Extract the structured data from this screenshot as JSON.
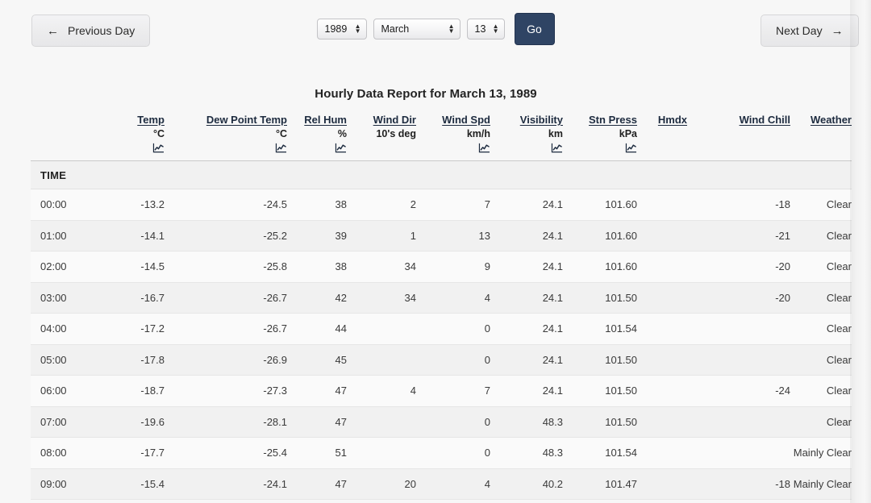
{
  "nav": {
    "prev_label": "Previous Day",
    "prev_icon": "arrow-left-icon",
    "prev_arrow": "←",
    "next_label": "Next Day",
    "next_icon": "arrow-right-icon",
    "next_arrow": "→",
    "go_label": "Go"
  },
  "date_picker": {
    "year": "1989",
    "month": "March",
    "day": "13",
    "spinner_up": "▲",
    "spinner_down": "▼"
  },
  "report": {
    "title": "Hourly Data Report for March 13, 1989",
    "time_header": "TIME"
  },
  "colors": {
    "page_background": "#f7f7f7",
    "go_button": "#2f4464",
    "header_link": "#1d2b3f",
    "row_odd": "#fafafa",
    "row_even": "#f1f1f1",
    "row_border": "#e6e6e6",
    "text": "#3a3a3a"
  },
  "columns": [
    {
      "key": "time",
      "name": "",
      "unit": "",
      "icon": ""
    },
    {
      "key": "temp",
      "name": "Temp",
      "unit": "°C",
      "icon": "line-chart-icon"
    },
    {
      "key": "dew_point",
      "name": "Dew Point Temp",
      "unit": "°C",
      "icon": "line-chart-icon"
    },
    {
      "key": "rel_hum",
      "name": "Rel Hum",
      "unit": "%",
      "icon": "line-chart-icon"
    },
    {
      "key": "wind_dir",
      "name": "Wind Dir",
      "unit": "10's deg",
      "icon": ""
    },
    {
      "key": "wind_spd",
      "name": "Wind Spd",
      "unit": "km/h",
      "icon": "line-chart-icon"
    },
    {
      "key": "visibility",
      "name": "Visibility",
      "unit": "km",
      "icon": "line-chart-icon"
    },
    {
      "key": "stn_press",
      "name": "Stn Press",
      "unit": "kPa",
      "icon": "line-chart-icon"
    },
    {
      "key": "hmdx",
      "name": "Hmdx",
      "unit": "",
      "icon": ""
    },
    {
      "key": "wind_chill",
      "name": "Wind Chill",
      "unit": "",
      "icon": ""
    },
    {
      "key": "weather",
      "name": "Weather",
      "unit": "",
      "icon": ""
    }
  ],
  "rows": [
    {
      "time": "00:00",
      "temp": "-13.2",
      "dew_point": "-24.5",
      "rel_hum": "38",
      "wind_dir": "2",
      "wind_spd": "7",
      "visibility": "24.1",
      "stn_press": "101.60",
      "hmdx": "",
      "wind_chill": "-18",
      "weather": "Clear"
    },
    {
      "time": "01:00",
      "temp": "-14.1",
      "dew_point": "-25.2",
      "rel_hum": "39",
      "wind_dir": "1",
      "wind_spd": "13",
      "visibility": "24.1",
      "stn_press": "101.60",
      "hmdx": "",
      "wind_chill": "-21",
      "weather": "Clear"
    },
    {
      "time": "02:00",
      "temp": "-14.5",
      "dew_point": "-25.8",
      "rel_hum": "38",
      "wind_dir": "34",
      "wind_spd": "9",
      "visibility": "24.1",
      "stn_press": "101.60",
      "hmdx": "",
      "wind_chill": "-20",
      "weather": "Clear"
    },
    {
      "time": "03:00",
      "temp": "-16.7",
      "dew_point": "-26.7",
      "rel_hum": "42",
      "wind_dir": "34",
      "wind_spd": "4",
      "visibility": "24.1",
      "stn_press": "101.50",
      "hmdx": "",
      "wind_chill": "-20",
      "weather": "Clear"
    },
    {
      "time": "04:00",
      "temp": "-17.2",
      "dew_point": "-26.7",
      "rel_hum": "44",
      "wind_dir": "",
      "wind_spd": "0",
      "visibility": "24.1",
      "stn_press": "101.54",
      "hmdx": "",
      "wind_chill": "",
      "weather": "Clear"
    },
    {
      "time": "05:00",
      "temp": "-17.8",
      "dew_point": "-26.9",
      "rel_hum": "45",
      "wind_dir": "",
      "wind_spd": "0",
      "visibility": "24.1",
      "stn_press": "101.50",
      "hmdx": "",
      "wind_chill": "",
      "weather": "Clear"
    },
    {
      "time": "06:00",
      "temp": "-18.7",
      "dew_point": "-27.3",
      "rel_hum": "47",
      "wind_dir": "4",
      "wind_spd": "7",
      "visibility": "24.1",
      "stn_press": "101.50",
      "hmdx": "",
      "wind_chill": "-24",
      "weather": "Clear"
    },
    {
      "time": "07:00",
      "temp": "-19.6",
      "dew_point": "-28.1",
      "rel_hum": "47",
      "wind_dir": "",
      "wind_spd": "0",
      "visibility": "48.3",
      "stn_press": "101.50",
      "hmdx": "",
      "wind_chill": "",
      "weather": "Clear"
    },
    {
      "time": "08:00",
      "temp": "-17.7",
      "dew_point": "-25.4",
      "rel_hum": "51",
      "wind_dir": "",
      "wind_spd": "0",
      "visibility": "48.3",
      "stn_press": "101.54",
      "hmdx": "",
      "wind_chill": "",
      "weather": "Mainly Clear"
    },
    {
      "time": "09:00",
      "temp": "-15.4",
      "dew_point": "-24.1",
      "rel_hum": "47",
      "wind_dir": "20",
      "wind_spd": "4",
      "visibility": "40.2",
      "stn_press": "101.47",
      "hmdx": "",
      "wind_chill": "-18",
      "weather": "Mainly Clear"
    }
  ]
}
